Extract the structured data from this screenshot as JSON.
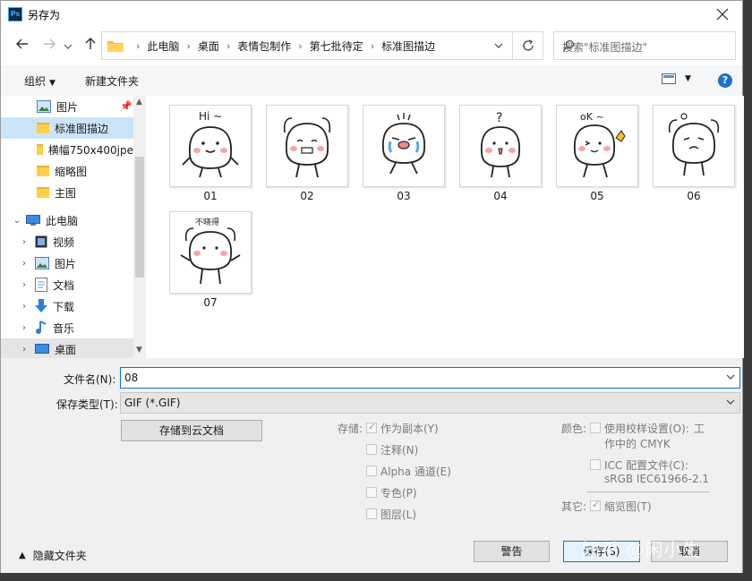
{
  "window": {
    "title": "另存为",
    "app_icon_text": "Ps"
  },
  "address": {
    "crumbs": [
      "此电脑",
      "桌面",
      "表情包制作",
      "第七批待定",
      "标准图描边"
    ]
  },
  "search": {
    "placeholder": "搜索\"标准图描边\""
  },
  "toolbar": {
    "organize": "组织",
    "new_folder": "新建文件夹",
    "help": "?"
  },
  "nav": {
    "items": [
      {
        "label": "图片"
      },
      {
        "label": "标准图描边"
      },
      {
        "label": "横幅750x400jpe"
      },
      {
        "label": "缩略图"
      },
      {
        "label": "主图"
      },
      {
        "label": "此电脑"
      },
      {
        "label": "视频"
      },
      {
        "label": "图片"
      },
      {
        "label": "文档"
      },
      {
        "label": "下载"
      },
      {
        "label": "音乐"
      },
      {
        "label": "桌面"
      }
    ]
  },
  "thumbs": [
    {
      "label": "01",
      "caption": "Hi ~"
    },
    {
      "label": "02"
    },
    {
      "label": "03"
    },
    {
      "label": "04",
      "caption": "?"
    },
    {
      "label": "05",
      "caption": "oK ~"
    },
    {
      "label": "06"
    },
    {
      "label": "07",
      "caption": "不晓得"
    }
  ],
  "form": {
    "filename_label": "文件名(N):",
    "filename_value": "08",
    "filetype_label": "保存类型(T):",
    "filetype_value": "GIF (*.GIF)",
    "cloud_button": "存储到云文档"
  },
  "options": {
    "save_label": "存储:",
    "as_copy": "作为副本(Y)",
    "notes": "注释(N)",
    "alpha": "Alpha 通道(E)",
    "spot": "专色(P)",
    "layers": "图层(L)",
    "color_label": "颜色:",
    "proof_line1": "使用校样设置(O):",
    "proof_line1b": "工",
    "proof_line2": "作中的 CMYK",
    "icc_line1": "ICC 配置文件(C):",
    "icc_line2": "sRGB IEC61966-2.1",
    "other_label": "其它:",
    "thumbnail": "缩览图(T)"
  },
  "buttons": {
    "warning": "警告",
    "save": "保存(S)",
    "cancel": "取消"
  },
  "footer": {
    "hide_folders": "隐藏文件夹"
  },
  "watermark": "知乎 @闲小生"
}
